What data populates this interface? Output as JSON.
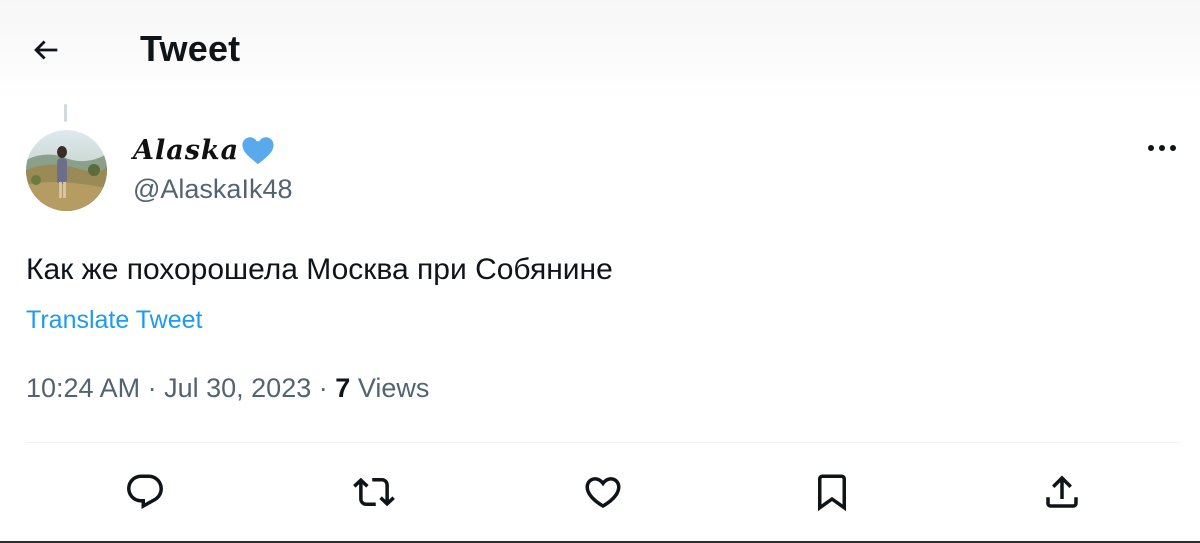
{
  "header": {
    "title": "Tweet",
    "back_icon": "arrow-left-icon"
  },
  "author": {
    "display_name": "Alaska",
    "badge_icon": "blue-heart-icon",
    "handle": "@AlaskaIk48"
  },
  "tweet": {
    "text": "Как же похорошела Москва при Собянине",
    "translate_label": "Translate Tweet",
    "time": "10:24 AM",
    "date": "Jul 30, 2023",
    "separator": "·",
    "views_count": "7",
    "views_label": "Views"
  },
  "actions": [
    {
      "icon": "reply-icon"
    },
    {
      "icon": "retweet-icon"
    },
    {
      "icon": "like-heart-icon"
    },
    {
      "icon": "bookmark-icon"
    },
    {
      "icon": "share-icon"
    }
  ],
  "colors": {
    "accent": "#1d9bf0",
    "secondary_text": "#536471",
    "heart_badge": "#5aa9ec"
  }
}
